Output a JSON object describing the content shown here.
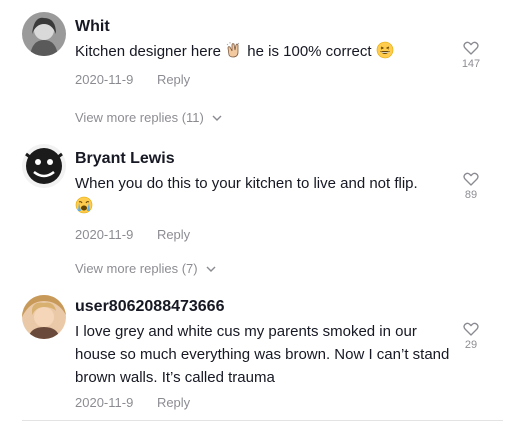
{
  "comments": [
    {
      "username": "Whit",
      "text_before": "Kitchen designer here",
      "emoji_mid": "clapping-hands-emoji",
      "text_after": "he is 100% correct",
      "emoji_end": "grinning-squinting-emoji",
      "date": "2020-11-9",
      "reply_label": "Reply",
      "likes": "147",
      "more_replies": "View more replies (11)"
    },
    {
      "username": "Bryant Lewis",
      "text": "When you do this to your kitchen to live and not flip.",
      "emoji_end": "loudly-crying-emoji",
      "date": "2020-11-9",
      "reply_label": "Reply",
      "likes": "89",
      "more_replies": "View more replies (7)"
    },
    {
      "username": "user8062088473666",
      "text": "I love grey and white cus my parents smoked in our house so much everything was brown. Now I can’t stand brown walls. It’s called trauma",
      "date": "2020-11-9",
      "reply_label": "Reply",
      "likes": "29"
    }
  ],
  "icons": {
    "like": "heart-outline-icon",
    "expand": "chevron-down-icon"
  },
  "colors": {
    "text": "#161823",
    "muted": "rgba(22,24,35,0.5)",
    "background": "#ffffff"
  }
}
